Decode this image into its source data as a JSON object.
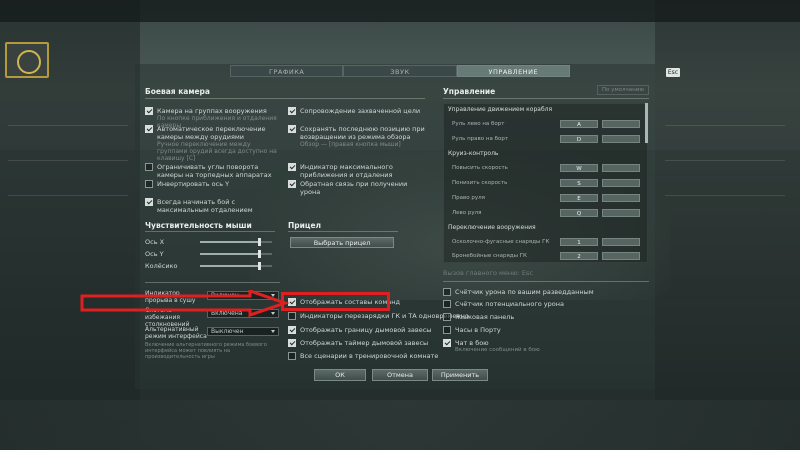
{
  "tabs": [
    "ГРАФИКА",
    "ЗВУК",
    "УПРАВЛЕНИЕ"
  ],
  "esc_label": "Esc",
  "combat_camera": {
    "title": "Боевая камера",
    "left": [
      {
        "label": "Камера на группах вооружения",
        "sub": "По кнопке приближения и отдаления камеры",
        "checked": true
      },
      {
        "label": "Автоматическое переключение камеры между орудиями",
        "sub": "Ручное переключение между группами орудий всегда доступно на клавишу [C]",
        "checked": true
      },
      {
        "label": "Ограничивать углы поворота камеры на торпедных аппаратах",
        "sub": "",
        "checked": false
      },
      {
        "label": "Инвертировать ось Y",
        "sub": "",
        "checked": false
      },
      {
        "label": "Всегда начинать бой с максимальным отдалением",
        "sub": "",
        "checked": true
      }
    ],
    "right": [
      {
        "label": "Сопровождение захваченной цели",
        "sub": "",
        "checked": true
      },
      {
        "label": "Сохранять последнюю позицию при возвращении из режима обзора",
        "sub": "Обзор — [правая кнопка мыши]",
        "checked": true
      },
      {
        "label": "Индикатор максимального приближения и отдаления",
        "sub": "",
        "checked": true
      },
      {
        "label": "Обратная связь при получении урона",
        "sub": "",
        "checked": true
      }
    ]
  },
  "mouse": {
    "title": "Чувствительность мыши",
    "sliders": [
      {
        "label": "Ось X",
        "value": 0.82
      },
      {
        "label": "Ось Y",
        "value": 0.82
      },
      {
        "label": "Колёсико",
        "value": 0.82
      }
    ]
  },
  "crosshair": {
    "title": "Прицел",
    "button": "Выбрать прицел"
  },
  "bottom_left": [
    {
      "label": "Индикатор прорыва в сушу",
      "value": "Включен"
    },
    {
      "label": "Система избежания столкновений",
      "value": "Включена"
    },
    {
      "label": "Альтернативный режим интерфейса",
      "value": "Выключен",
      "sub": "Включение альтернативного режима боевого интерфейса может повлиять на производительность игры"
    }
  ],
  "middle_checks": [
    {
      "label": "Отображать составы команд",
      "checked": true
    },
    {
      "label": "Индикаторы перезарядки ГК и ТА одновременно",
      "checked": false
    },
    {
      "label": "Отображать границу дымовой завесы",
      "checked": true
    },
    {
      "label": "Отображать таймер дымовой завесы",
      "checked": true
    },
    {
      "label": "Все сценарии в тренировочной комнате",
      "checked": false
    }
  ],
  "controls": {
    "title": "Управление",
    "defaults_button": "По умолчанию",
    "groups": [
      {
        "title": "Управление движением корабля",
        "rows": [
          {
            "name": "Руль лево на борт",
            "key": "A"
          },
          {
            "name": "Руль право на борт",
            "key": "D"
          }
        ]
      },
      {
        "title": "Круиз-контроль",
        "rows": [
          {
            "name": "Повысить скорость",
            "key": "W"
          },
          {
            "name": "Понизить скорость",
            "key": "S"
          },
          {
            "name": "Право руля",
            "key": "E"
          },
          {
            "name": "Лево руля",
            "key": "Q"
          }
        ]
      },
      {
        "title": "Переключение вооружения",
        "rows": [
          {
            "name": "Осколочно-фугасные снаряды ГК",
            "key": "1"
          },
          {
            "name": "Бронебойные снаряды ГК",
            "key": "2"
          }
        ]
      }
    ],
    "main_menu_hint": "Вызов главного меню: Esc"
  },
  "right_checks": [
    {
      "label": "Счётчик урона по вашим разведданным",
      "checked": false,
      "sub": ""
    },
    {
      "label": "Счётчик потенциального урона",
      "checked": false,
      "sub": ""
    },
    {
      "label": "Языковая панель",
      "checked": false,
      "sub": ""
    },
    {
      "label": "Часы в Порту",
      "checked": false,
      "sub": ""
    },
    {
      "label": "Чат в бою",
      "checked": true,
      "sub": "Включение сообщений в бою"
    }
  ],
  "buttons": {
    "ok": "ОК",
    "cancel": "Отмена",
    "apply": "Применить"
  },
  "colors": {
    "highlight": "#e02020",
    "panel": "#34423f"
  }
}
